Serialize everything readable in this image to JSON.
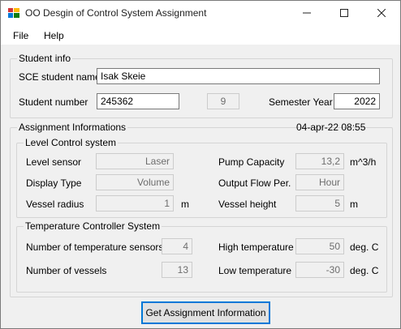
{
  "window": {
    "title": "OO Desgin of Control System Assignment",
    "minimize_glyph": "—",
    "maximize_glyph": "☐",
    "close_glyph": "✕"
  },
  "menu": {
    "file": "File",
    "help": "Help"
  },
  "student_info": {
    "group_label": "Student info",
    "name_label": "SCE student name",
    "name_value": "Isak Skeie",
    "number_label": "Student number",
    "number_value": "245362",
    "digit_value": "9",
    "semester_label": "Semester Year",
    "semester_value": "2022"
  },
  "assignment": {
    "group_label": "Assignment Informations",
    "timestamp": "04-apr-22 08:55"
  },
  "level": {
    "group_label": "Level Control system",
    "sensor_label": "Level sensor",
    "sensor_value": "Laser",
    "display_label": "Display Type",
    "display_value": "Volume",
    "radius_label": "Vessel radius",
    "radius_value": "1",
    "radius_unit": "m",
    "pump_label": "Pump Capacity",
    "pump_value": "13,2",
    "pump_unit": "m^3/h",
    "flow_label": "Output Flow Per.",
    "flow_value": "Hour",
    "height_label": "Vessel height",
    "height_value": "5",
    "height_unit": "m"
  },
  "temperature": {
    "group_label": "Temperature Controller System",
    "sensors_label": "Number of temperature sensors",
    "sensors_value": "4",
    "vessels_label": "Number of vessels",
    "vessels_value": "13",
    "high_label": "High temperature",
    "high_value": "50",
    "high_unit": "deg. C",
    "low_label": "Low temperature",
    "low_value": "-30",
    "low_unit": "deg. C"
  },
  "actions": {
    "get_info": "Get Assignment  Information"
  }
}
